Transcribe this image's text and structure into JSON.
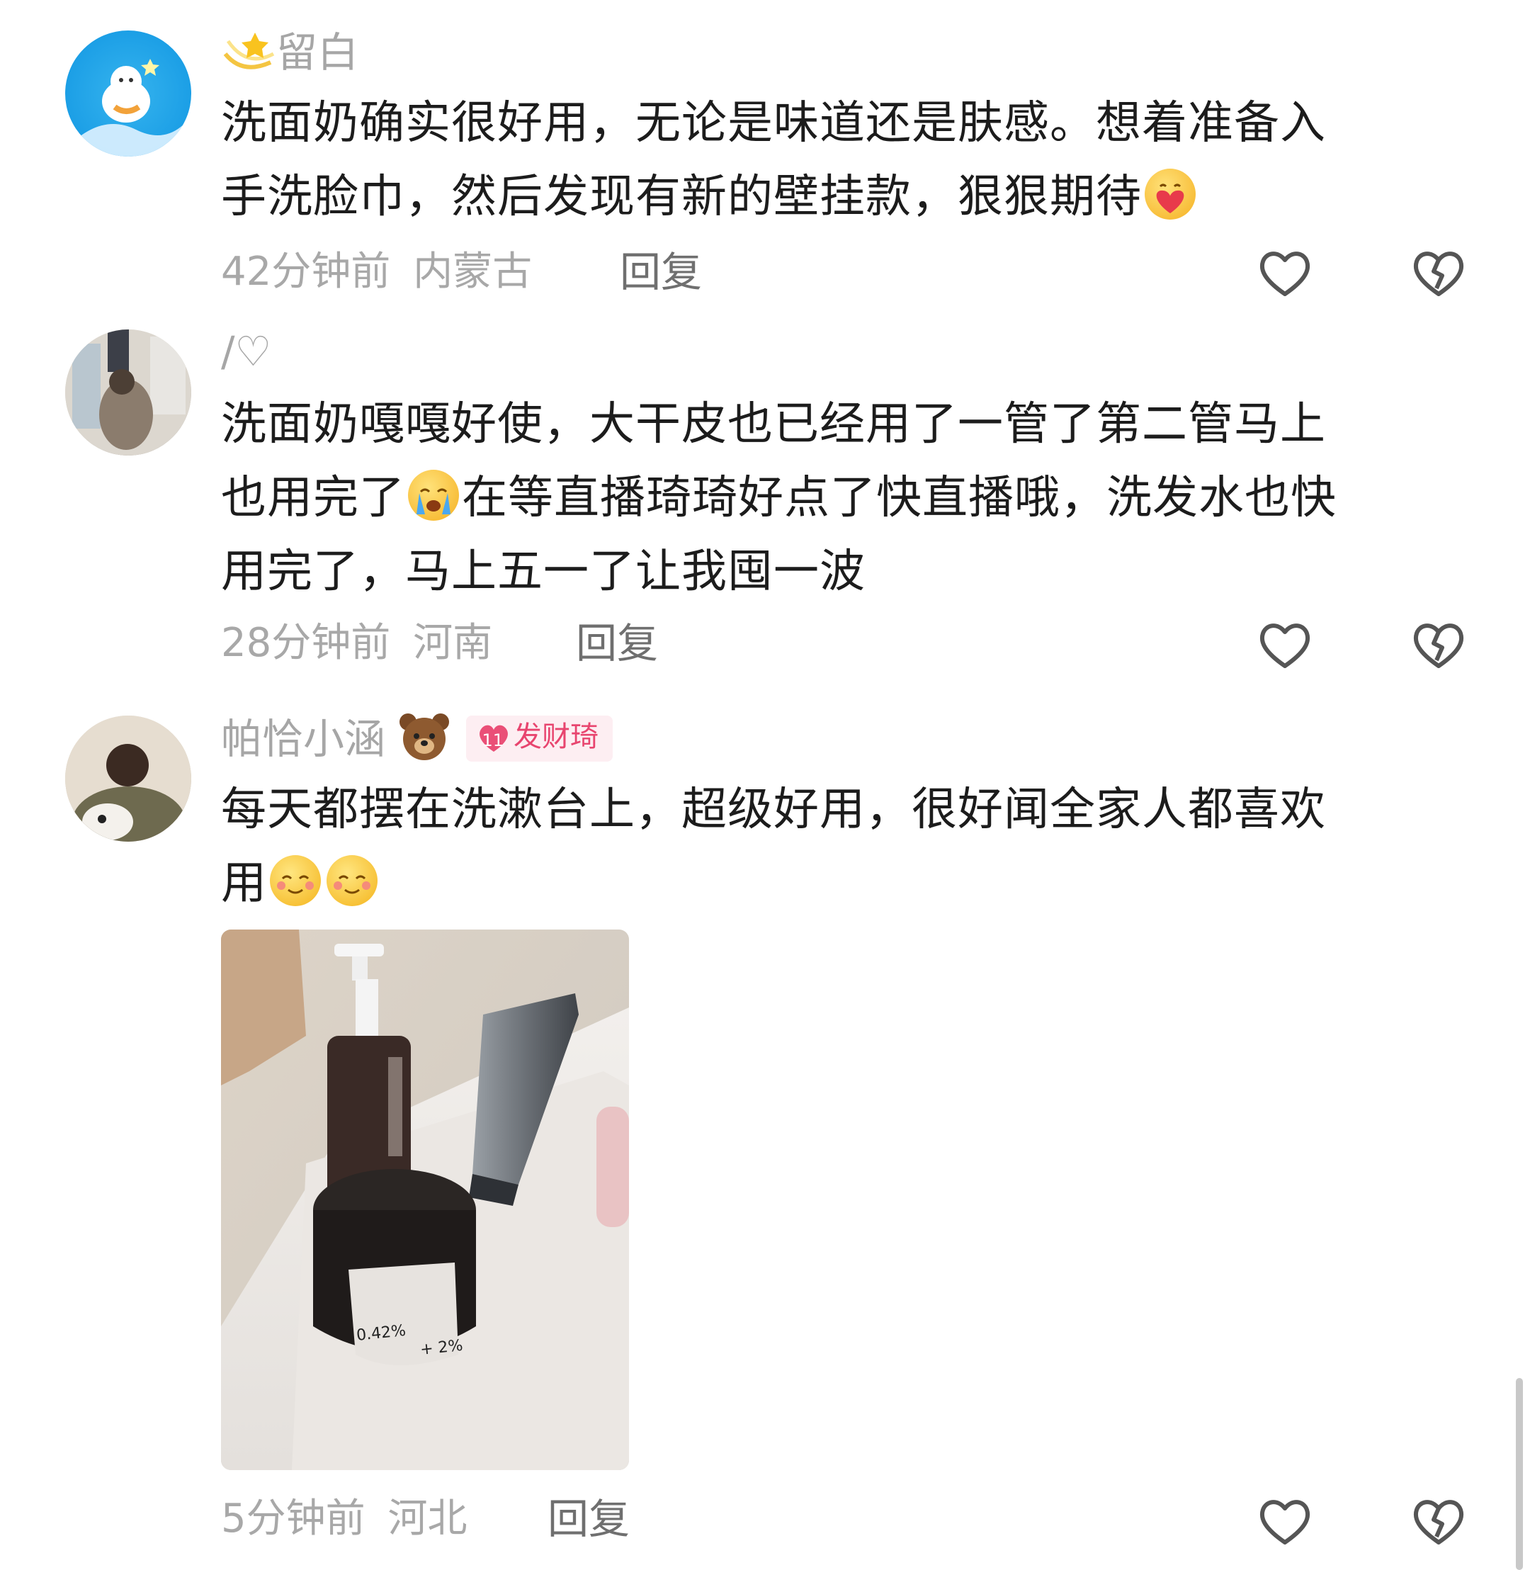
{
  "comments": [
    {
      "username": "留白",
      "text_1": "洗面奶确实很好用，无论是味道还是肤感。想着准备入",
      "text_2": "手洗脸巾，然后发现有新的壁挂款，狠狠期待",
      "time": "42分钟前",
      "location": "内蒙古",
      "reply_label": "回复"
    },
    {
      "username": "/♡",
      "text_1": "洗面奶嘎嘎好使，大干皮也已经用了一管了第二管马上",
      "text_2a": "也用完了",
      "text_2b": "在等直播琦琦好点了快直播哦，洗发水也快",
      "text_3": "用完了，马上五一了让我囤一波",
      "time": "28分钟前",
      "location": "河南",
      "reply_label": "回复"
    },
    {
      "username": "帕恰小涵",
      "badge_level": "11",
      "badge_text": "发财琦",
      "text_1": "每天都摆在洗漱台上，超级好用，很好闻全家人都喜欢",
      "text_2": "用",
      "photo_label_1": "0.42%",
      "photo_label_2": "+ 2%",
      "time": "5分钟前",
      "location": "河北",
      "reply_label": "回复"
    }
  ],
  "icons": {
    "like": "heart-outline-icon",
    "dislike": "broken-heart-icon"
  },
  "colors": {
    "text": "#1c1c1c",
    "meta": "#a8a8a8",
    "badge_bg": "#fdeef2",
    "badge_fg": "#e8456f"
  }
}
